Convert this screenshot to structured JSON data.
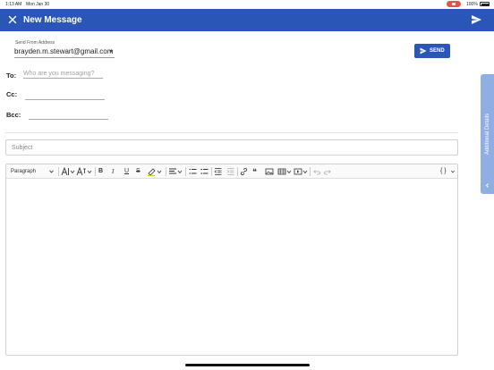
{
  "status_bar": {
    "time": "1:13 AM",
    "date": "Mon Jan 30",
    "battery": "100%"
  },
  "app_bar": {
    "title": "New Message",
    "color": "#2a56b8"
  },
  "from": {
    "label": "Send From Address",
    "value": "brayden.m.stewart@gmail.com"
  },
  "send_button": {
    "label": "SEND"
  },
  "fields": {
    "to_label": "To:",
    "to_placeholder": "Who are you messaging?",
    "cc_label": "Cc:",
    "bcc_label": "Bcc:"
  },
  "subject": {
    "placeholder": "Subject"
  },
  "toolbar": {
    "paragraph": "Paragraph",
    "bold": "B",
    "italic": "I",
    "underline": "U",
    "strike": "S",
    "quote": "❝",
    "code": "{ }"
  },
  "side_tab": {
    "label": "Additional Details"
  }
}
